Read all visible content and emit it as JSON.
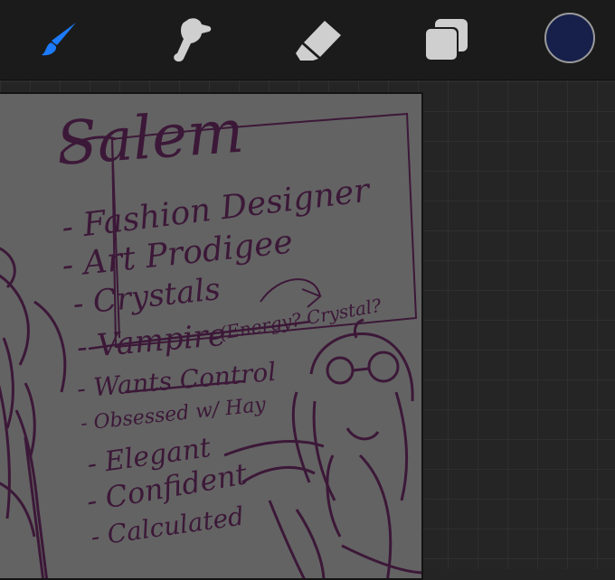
{
  "toolbar": {
    "tools": [
      {
        "name": "brush",
        "icon": "brush-icon",
        "active": true
      },
      {
        "name": "smudge",
        "icon": "smudge-icon",
        "active": false
      },
      {
        "name": "eraser",
        "icon": "eraser-icon",
        "active": false
      },
      {
        "name": "layers",
        "icon": "layers-icon",
        "active": false
      }
    ],
    "active_color": "#16204a",
    "accent_color": "#1c7bff",
    "icon_color": "#cfcfcf"
  },
  "canvas": {
    "background_color": "#636363",
    "ink_color": "#3c1838",
    "sketch": {
      "title": "Salem",
      "notes": [
        "- Fashion Designer",
        "- Art Prodigee",
        "- Crystals",
        "- Vampire",
        "(Energy? Crystal?",
        "- Wants Control",
        "- Obsessed w/ Hay",
        "- Elegant",
        "- Confident",
        "- Calculated"
      ]
    }
  }
}
